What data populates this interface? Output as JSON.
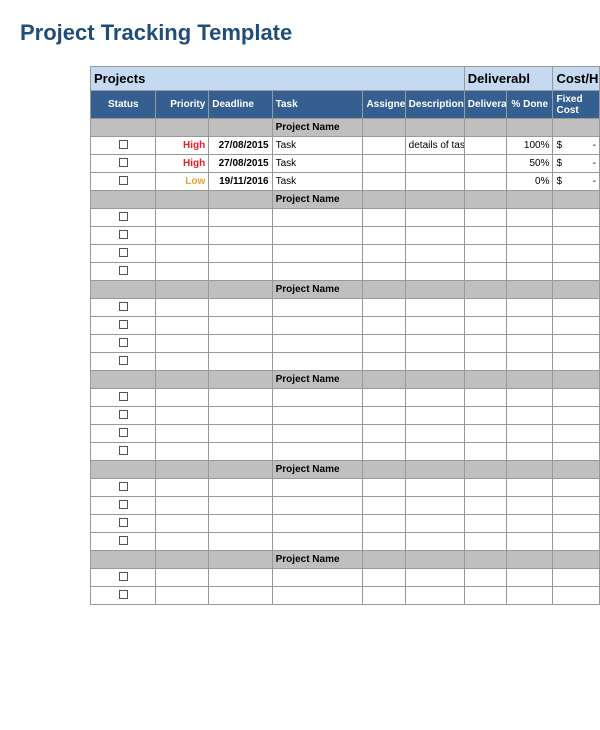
{
  "title": "Project Tracking Template",
  "groupHeaders": {
    "g1": "Projects",
    "g2": "Deliverabl",
    "g3": "Cost/H"
  },
  "columns": {
    "status": "Status",
    "priority": "Priority",
    "deadline": "Deadline",
    "task": "Task",
    "assignee": "Assignee",
    "description": "Description",
    "deliverable": "Delivera",
    "done": "% Done",
    "cost": "Fixed Cost"
  },
  "sectionLabel": "Project Name",
  "costPrefix": "$",
  "costDash": "-",
  "sections": [
    {
      "rows": [
        {
          "priority": "High",
          "priorityClass": "prio-high",
          "deadline": "27/08/2015",
          "task": "Task",
          "description": "details of task here",
          "done": "100%",
          "cost": true
        },
        {
          "priority": "High",
          "priorityClass": "prio-high",
          "deadline": "27/08/2015",
          "task": "Task",
          "description": "",
          "done": "50%",
          "cost": true
        },
        {
          "priority": "Low",
          "priorityClass": "prio-low",
          "deadline": "19/11/2016",
          "task": "Task",
          "description": "",
          "done": "0%",
          "cost": true
        }
      ]
    },
    {
      "rows": [
        {},
        {},
        {},
        {}
      ]
    },
    {
      "rows": [
        {},
        {},
        {},
        {}
      ]
    },
    {
      "rows": [
        {},
        {},
        {},
        {}
      ]
    },
    {
      "rows": [
        {},
        {},
        {},
        {}
      ]
    },
    {
      "rows": [
        {},
        {}
      ]
    }
  ]
}
